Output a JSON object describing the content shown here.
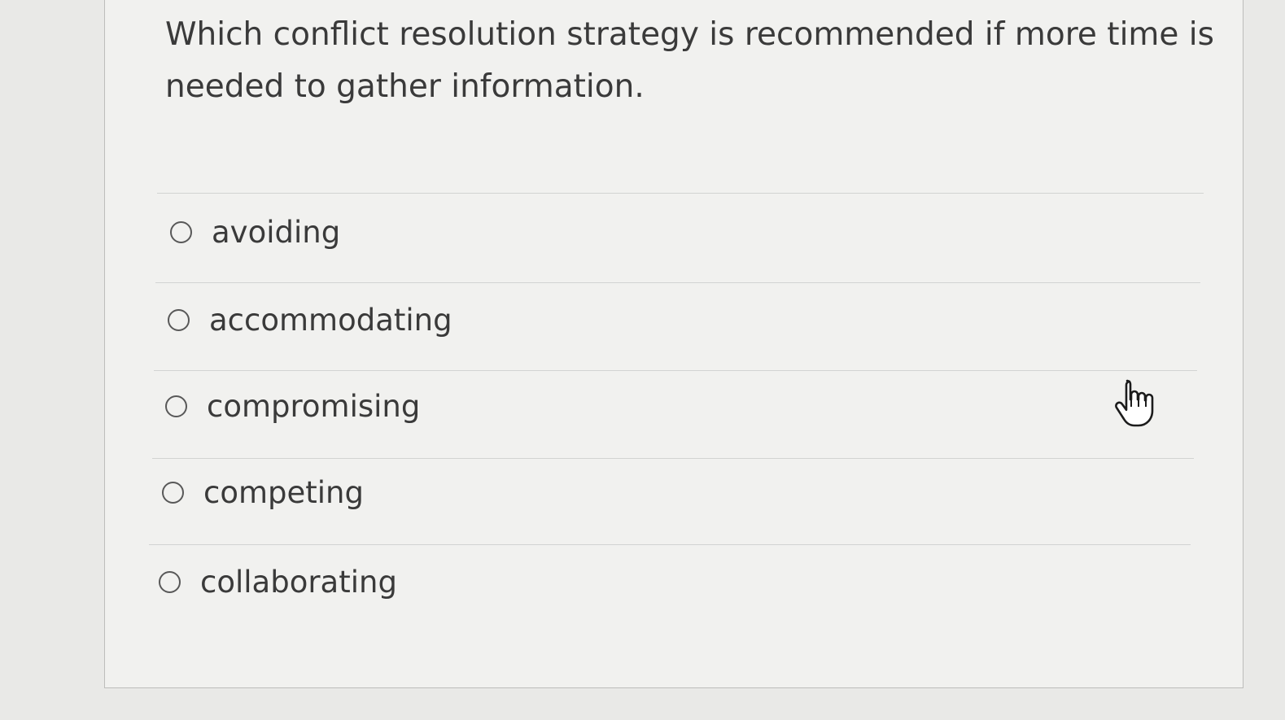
{
  "question": {
    "text": "Which conflict resolution strategy is recommended if more time is needed to gather information."
  },
  "options": [
    {
      "label": "avoiding",
      "selected": false
    },
    {
      "label": "accommodating",
      "selected": false
    },
    {
      "label": "compromising",
      "selected": false
    },
    {
      "label": "competing",
      "selected": false
    },
    {
      "label": "collaborating",
      "selected": false
    }
  ],
  "cursor": {
    "icon": "hand-pointer-icon"
  }
}
